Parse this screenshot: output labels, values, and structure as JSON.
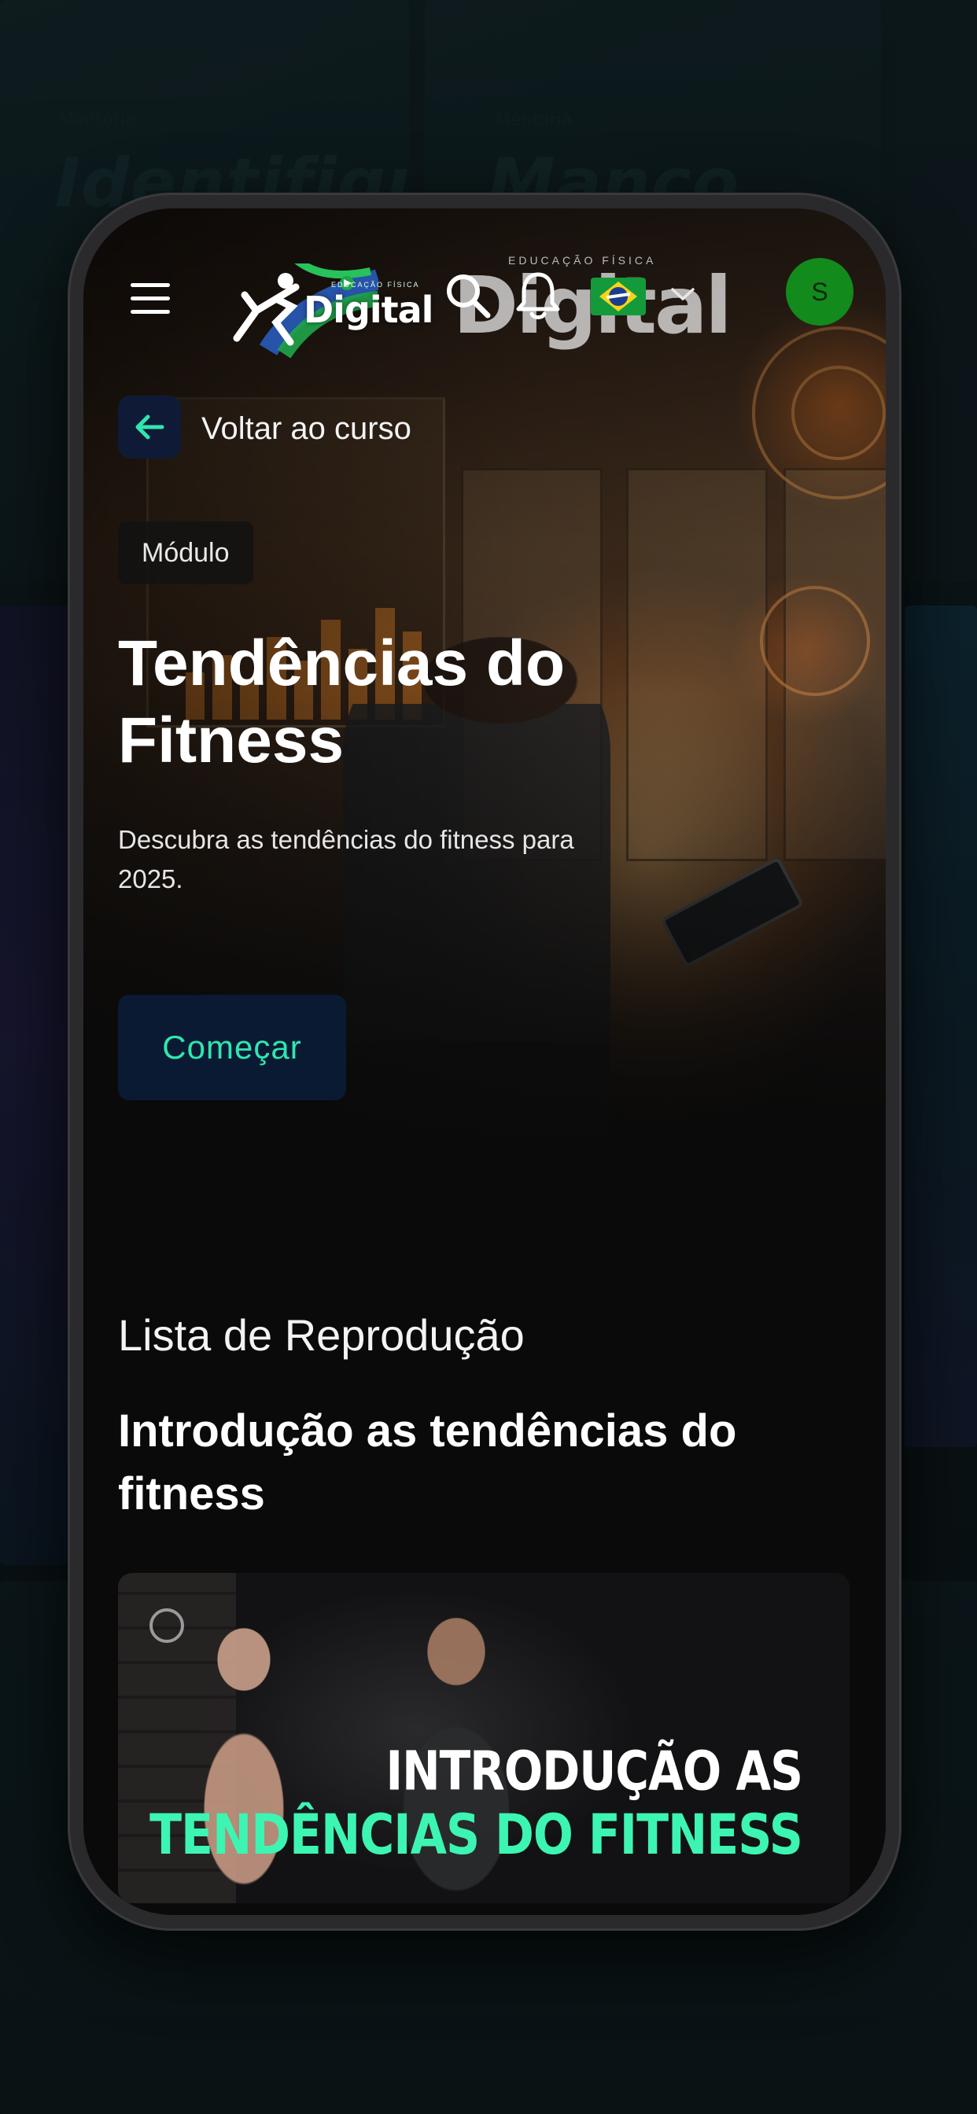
{
  "app": {
    "logo_text": "Digital",
    "logo_tagline": "EDUCAÇÃO FÍSICA",
    "watermark_tagline": "EDUCAÇÃO FÍSICA",
    "watermark_text": "Digital"
  },
  "header": {
    "menu_icon": "hamburger-menu-icon",
    "search_icon": "search-icon",
    "notifications_icon": "bell-icon",
    "language_flag": "brazil-flag-icon",
    "language_chevron": "chevron-down-icon",
    "user_initial": "S"
  },
  "navigation": {
    "back_label": "Voltar ao curso"
  },
  "module": {
    "badge": "Módulo",
    "title": "Tendências do Fitness",
    "description": "Descubra as tendências do fitness para 2025.",
    "start_label": "Começar"
  },
  "playlist": {
    "heading": "Lista de Reprodução",
    "items": [
      {
        "title": "Introdução as tendências do fitness",
        "thumbnail_line1": "INTRODUÇÃO AS",
        "thumbnail_line2": "TENDÊNCIAS DO FITNESS"
      }
    ]
  },
  "colors": {
    "accent": "#2fe6b0",
    "button_bg": "#0b1a33",
    "avatar_bg": "#138a1c",
    "background": "#0a0a0a"
  }
}
